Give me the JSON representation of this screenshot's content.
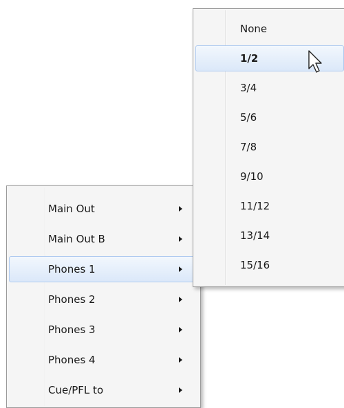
{
  "main_menu": {
    "items": [
      {
        "label": "Main Out",
        "highlighted": false,
        "has_submenu": true
      },
      {
        "label": "Main Out B",
        "highlighted": false,
        "has_submenu": true
      },
      {
        "label": "Phones 1",
        "highlighted": true,
        "has_submenu": true
      },
      {
        "label": "Phones 2",
        "highlighted": false,
        "has_submenu": true
      },
      {
        "label": "Phones 3",
        "highlighted": false,
        "has_submenu": true
      },
      {
        "label": "Phones 4",
        "highlighted": false,
        "has_submenu": true
      },
      {
        "label": "Cue/PFL to",
        "highlighted": false,
        "has_submenu": true
      }
    ]
  },
  "submenu": {
    "items": [
      {
        "label": "None",
        "highlighted": false,
        "bold": false
      },
      {
        "label": "1/2",
        "highlighted": true,
        "bold": true
      },
      {
        "label": "3/4",
        "highlighted": false,
        "bold": false
      },
      {
        "label": "5/6",
        "highlighted": false,
        "bold": false
      },
      {
        "label": "7/8",
        "highlighted": false,
        "bold": false
      },
      {
        "label": "9/10",
        "highlighted": false,
        "bold": false
      },
      {
        "label": "11/12",
        "highlighted": false,
        "bold": false
      },
      {
        "label": "13/14",
        "highlighted": false,
        "bold": false
      },
      {
        "label": "15/16",
        "highlighted": false,
        "bold": false
      }
    ]
  },
  "colors": {
    "highlight_border": "#aecaf0",
    "highlight_fill": "#dbe8f9",
    "menu_background": "#f5f5f5"
  },
  "cursor": {
    "icon": "mouse-pointer-icon"
  }
}
